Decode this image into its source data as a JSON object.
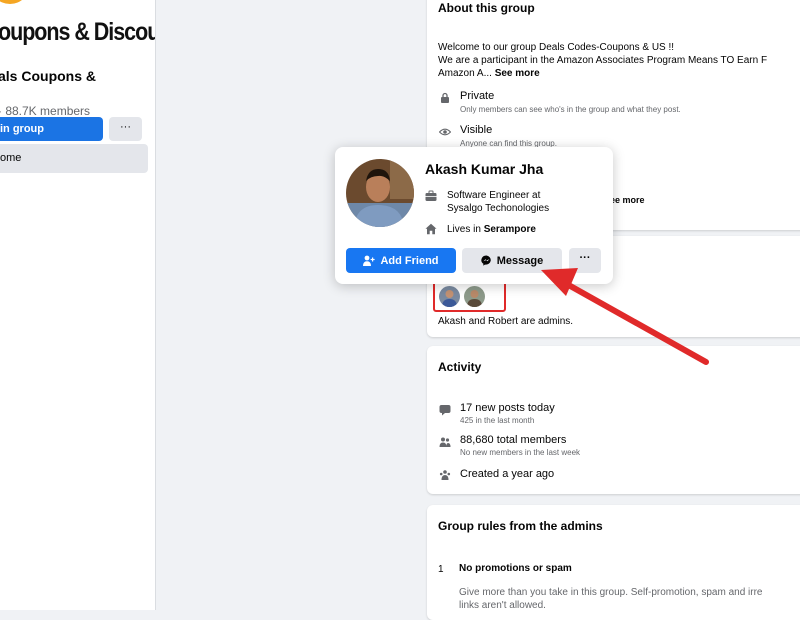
{
  "sidebar": {
    "cover_text": "oupons & Discount",
    "group_name": "als Coupons &",
    "members_text": "· 88.7K members",
    "join_label": "in group",
    "more_label": "···",
    "home_label": "ome"
  },
  "about": {
    "title": "About this group",
    "desc_line1": "Welcome to our group Deals Codes-Coupons & US !!",
    "desc_line2": "We are a participant in the Amazon Associates Program Means TO Earn F",
    "desc_line3": "Amazon A...",
    "see_more": "See more",
    "private_title": "Private",
    "private_desc": "Only members can see who's in the group and what they post.",
    "visible_title": "Visible",
    "visible_desc": "Anyone can find this group.",
    "hidden_see_more": "ee more"
  },
  "admins": {
    "text": "Akash and Robert are admins."
  },
  "activity": {
    "title": "Activity",
    "posts_title": "17 new posts today",
    "posts_sub": "425 in the last month",
    "members_title": "88,680 total members",
    "members_sub": "No new members in the last week",
    "created": "Created a year ago"
  },
  "rules": {
    "title": "Group rules from the admins",
    "rule1_num": "1",
    "rule1_title": "No promotions or spam",
    "rule1_line1": "Give more than you take in this group. Self-promotion, spam and irre",
    "rule1_line2": "links aren't allowed."
  },
  "popup": {
    "name": "Akash Kumar Jha",
    "work_line1": "Software Engineer at",
    "work_line2": "Sysalgo Techonologies",
    "lives_prefix": "Lives in",
    "lives_place": "Serampore",
    "add_friend": "Add Friend",
    "message": "Message",
    "more": "···"
  },
  "colors": {
    "accent_blue": "#1877f2",
    "highlight_red": "#e02a2a",
    "background": "#f0f2f5"
  }
}
